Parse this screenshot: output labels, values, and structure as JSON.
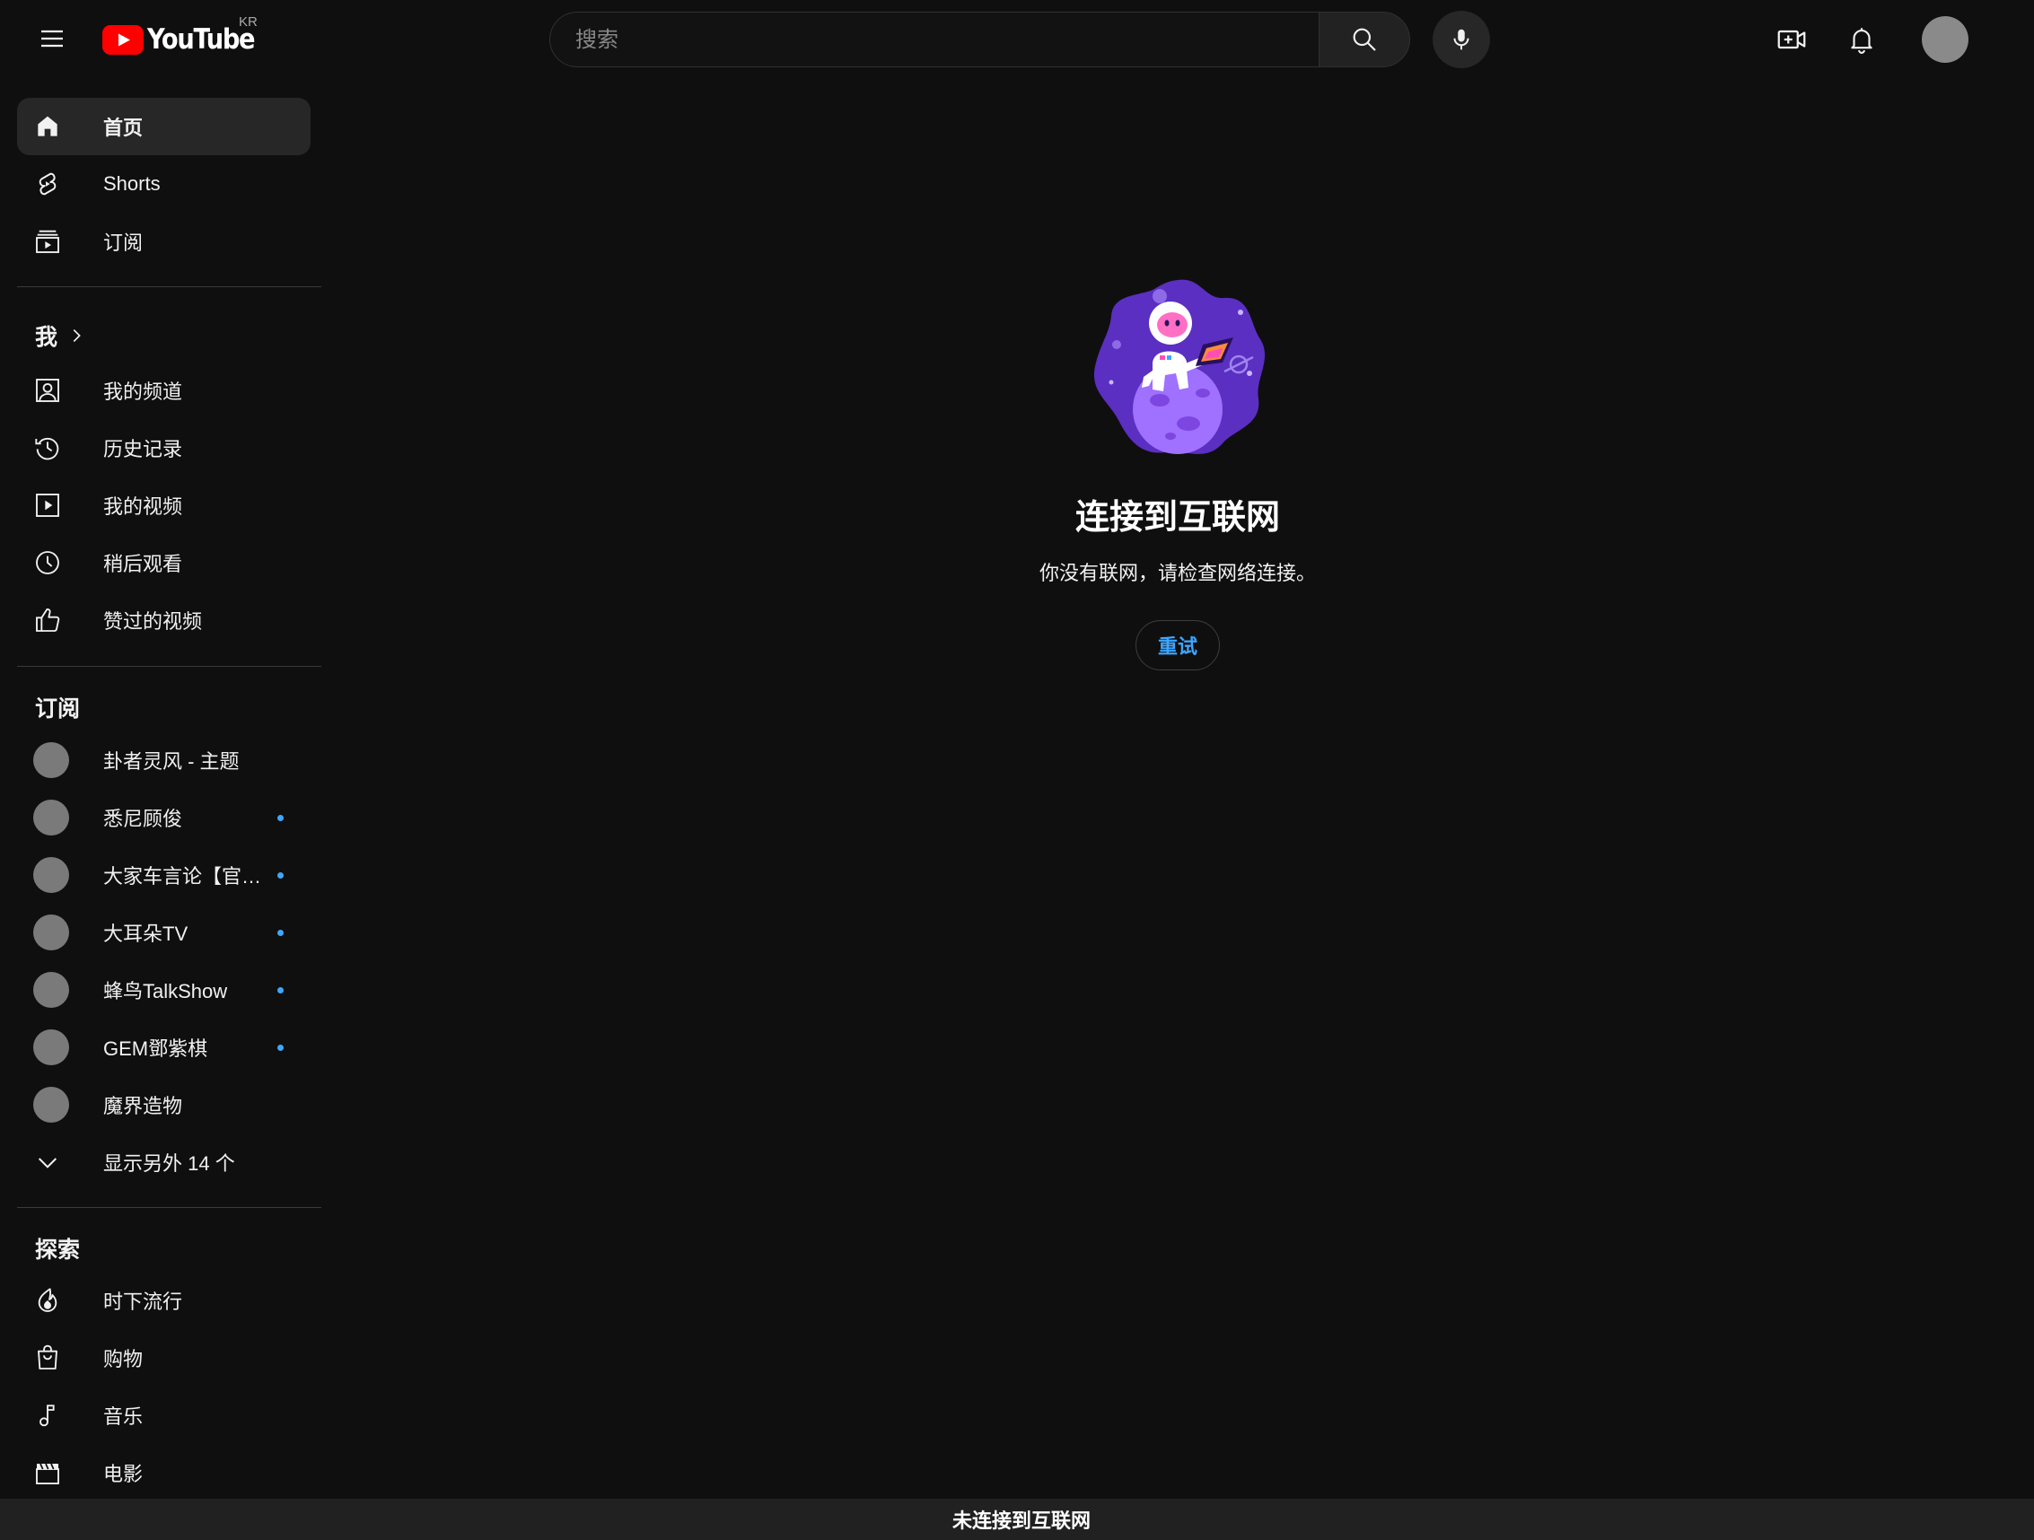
{
  "header": {
    "logo_text": "YouTube",
    "country_code": "KR",
    "search_placeholder": "搜索"
  },
  "sidebar": {
    "main": [
      {
        "label": "首页",
        "icon": "home-icon",
        "active": true
      },
      {
        "label": "Shorts",
        "icon": "shorts-icon"
      },
      {
        "label": "订阅",
        "icon": "subscriptions-icon"
      }
    ],
    "you": {
      "heading": "我",
      "items": [
        {
          "label": "我的频道",
          "icon": "your-channel-icon"
        },
        {
          "label": "历史记录",
          "icon": "history-icon"
        },
        {
          "label": "我的视频",
          "icon": "your-videos-icon"
        },
        {
          "label": "稍后观看",
          "icon": "watch-later-icon"
        },
        {
          "label": "赞过的视频",
          "icon": "liked-videos-icon"
        }
      ]
    },
    "subscriptions": {
      "heading": "订阅",
      "channels": [
        {
          "label": "卦者灵风 - 主题",
          "new": false
        },
        {
          "label": "悉尼顾俊",
          "new": true
        },
        {
          "label": "大家车言论【官方频道】",
          "new": true
        },
        {
          "label": "大耳朵TV",
          "new": true
        },
        {
          "label": "蜂鸟TalkShow",
          "new": true
        },
        {
          "label": "GEM鄧紫棋",
          "new": true
        },
        {
          "label": "魔界造物",
          "new": false
        }
      ],
      "show_more": "显示另外 14 个"
    },
    "explore": {
      "heading": "探索",
      "items": [
        {
          "label": "时下流行",
          "icon": "trending-icon"
        },
        {
          "label": "购物",
          "icon": "shopping-icon"
        },
        {
          "label": "音乐",
          "icon": "music-icon"
        },
        {
          "label": "电影",
          "icon": "movies-icon"
        }
      ]
    }
  },
  "main": {
    "title": "连接到互联网",
    "subtitle": "你没有联网，请检查网络连接。",
    "retry_label": "重试"
  },
  "status_bar": {
    "text": "未连接到互联网"
  },
  "colors": {
    "background": "#0f0f0f",
    "accent_red": "#ff0000",
    "link_blue": "#3ea6ff",
    "surface": "#272727"
  }
}
